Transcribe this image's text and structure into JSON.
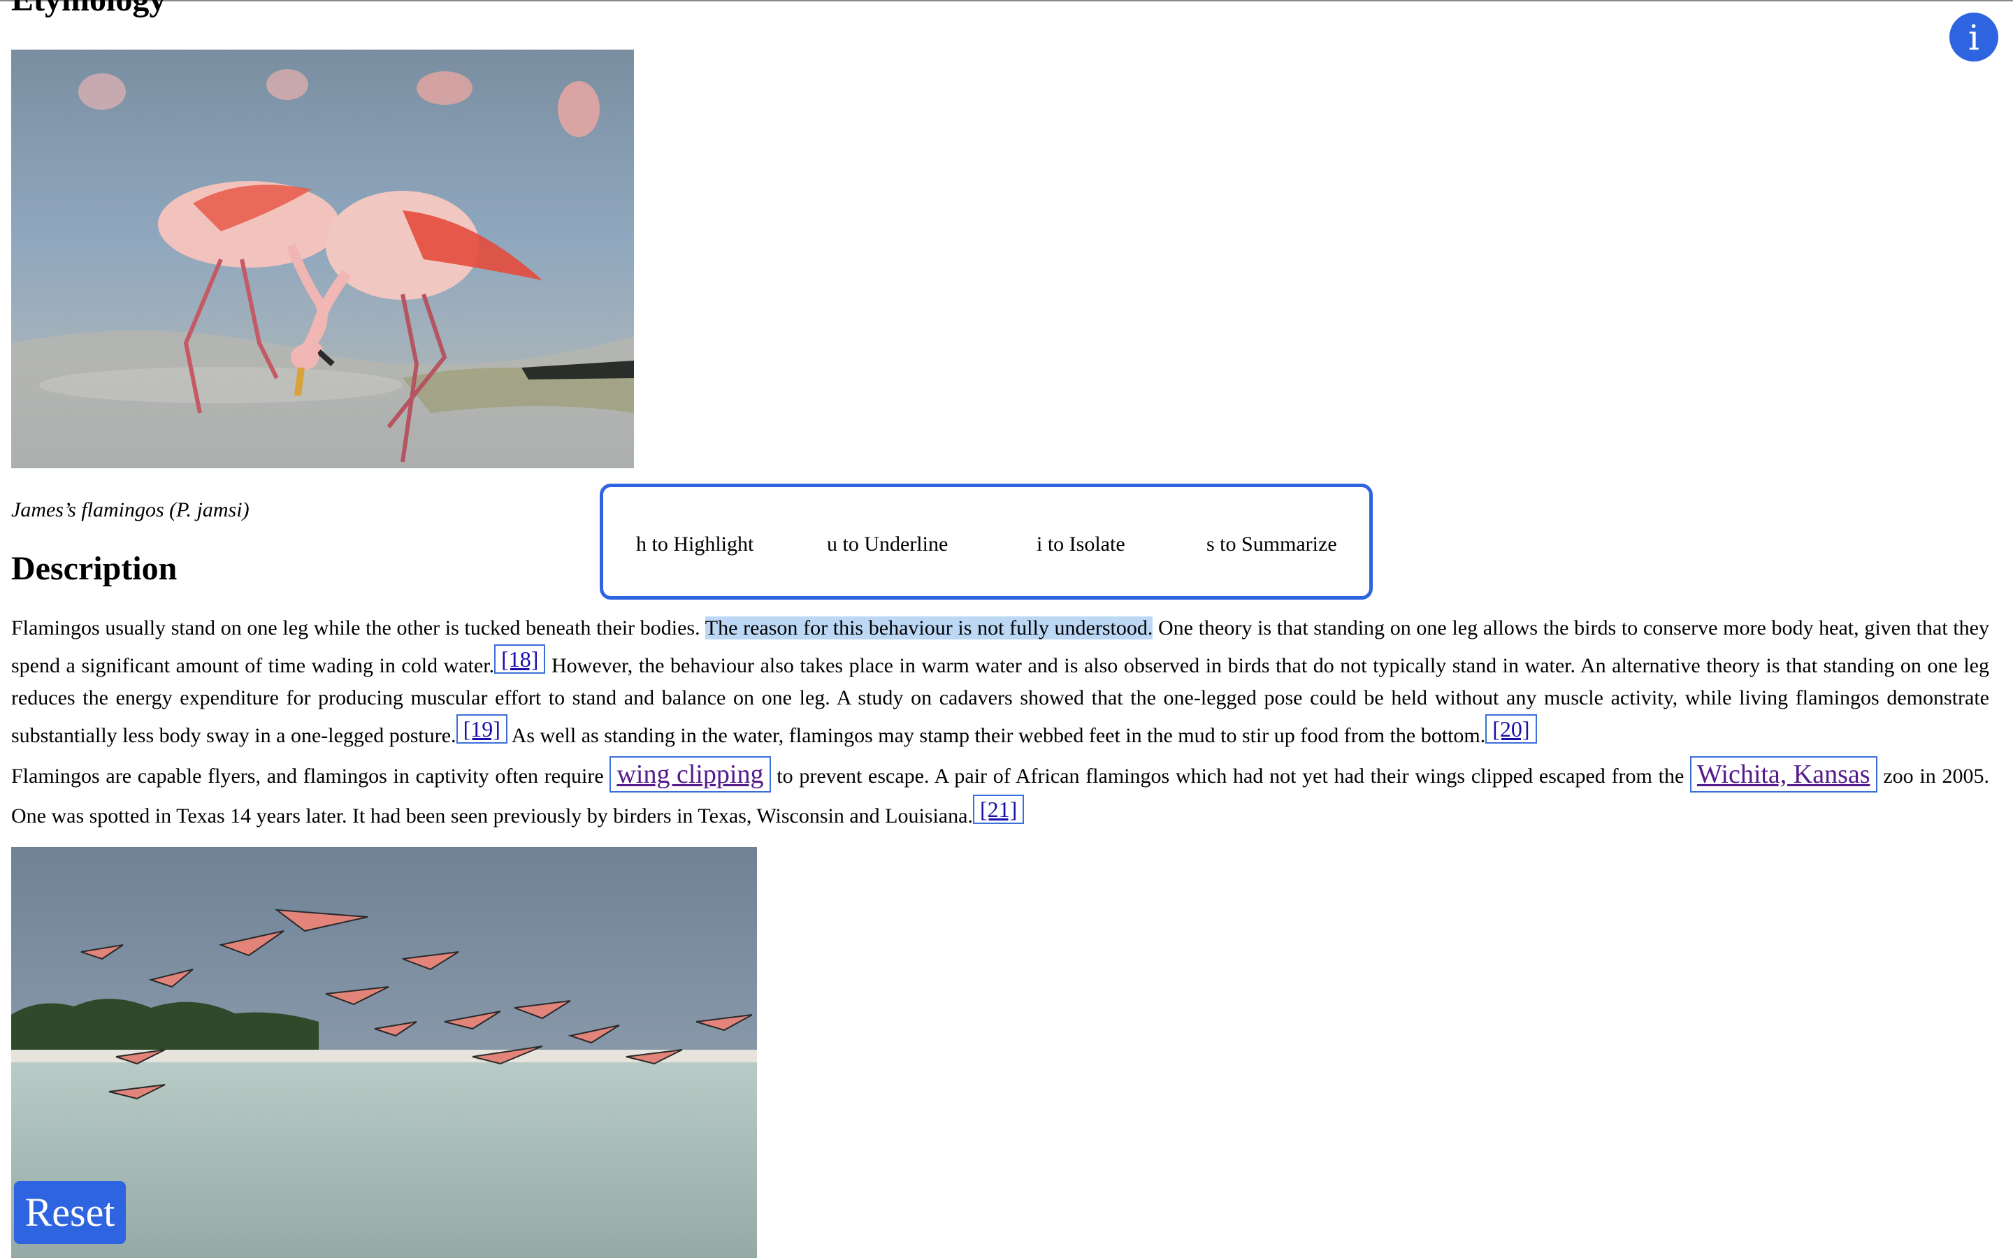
{
  "article": {
    "etymology_heading": "Etymology",
    "caption": "James’s flamingos (P. jamsi)",
    "description_heading": "Description",
    "p1": {
      "t1": "Flamingos usually stand on one leg while the other is tucked beneath their bodies. ",
      "highlighted": "The reason for this behaviour is not fully understood.",
      "t2": " One theory is that standing on one leg allows the birds to conserve more body heat, given that they spend a significant amount of time wading in cold water.",
      "ref18": "[18]",
      "t3": " However, the behaviour also takes place in warm water and is also observed in birds that do not typically stand in water. An alternative theory is that standing on one leg reduces the energy expenditure for producing muscular effort to stand and balance on one leg. A study on cadavers showed that the one-legged pose could be held without any muscle activity, while living flamingos demonstrate substantially less body sway in a one-legged posture.",
      "ref19": "[19]",
      "t4": " As well as standing in the water, flamingos may stamp their webbed feet in the mud to stir up food from the bottom.",
      "ref20": "[20]"
    },
    "p2": {
      "t1": "Flamingos are capable flyers, and flamingos in captivity often require ",
      "link1": "wing clipping",
      "t2": " to prevent escape. A pair of African flamingos which had not yet had their wings clipped escaped from the ",
      "link2": "Wichita, Kansas",
      "t3": " zoo in 2005. One was spotted in Texas 14 years later. It had been seen previously by birders in Texas, Wisconsin and Louisiana.",
      "ref21": "[21]"
    }
  },
  "shortcuts": {
    "highlight": "h to Highlight",
    "underline": "u to Underline",
    "isolate": "i to Isolate",
    "summarize": "s to Summarize"
  },
  "info_button": {
    "label": "i",
    "icon": "info-icon"
  },
  "reset_button": {
    "label": "Reset"
  },
  "colors": {
    "accent": "#2f64e0",
    "highlight": "#bcd8f5",
    "link_visited": "#551a8b",
    "ref_link": "#1a0dab"
  }
}
